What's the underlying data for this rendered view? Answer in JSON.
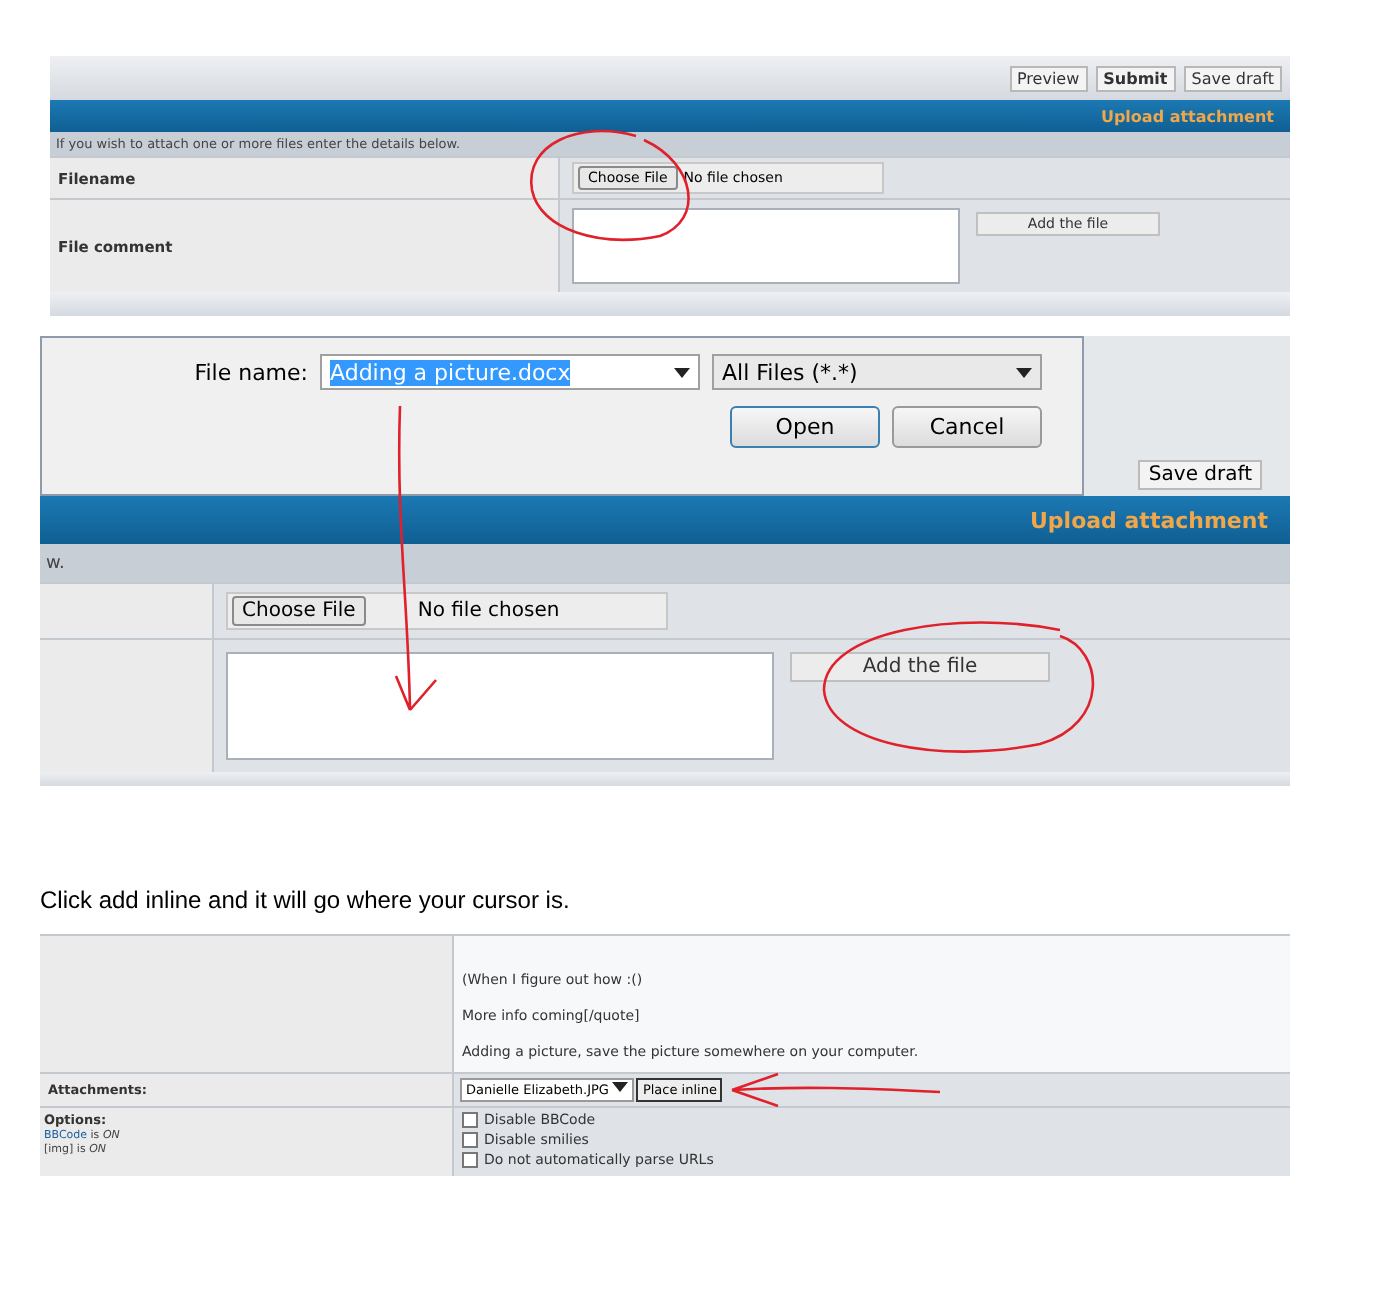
{
  "shot_upload_form": {
    "toolbar_buttons": [
      "Preview",
      "Submit",
      "Save draft"
    ],
    "header": "Upload attachment",
    "hint": "If you wish to attach one or more files enter the details below.",
    "filename_label": "Filename",
    "comment_label": "File comment",
    "choose_button": "Choose File",
    "no_file": "No file chosen",
    "add_button": "Add the file"
  },
  "shot_file_dialog": {
    "file_name_label": "File name:",
    "file_name_value": "Adding a picture.docx",
    "filter": "All Files (*.*)",
    "open_button": "Open",
    "cancel_button": "Cancel",
    "behind_button": "Save draft",
    "header": "Upload attachment",
    "hint_fragment": "w.",
    "choose_button": "Choose File",
    "no_file": "No file chosen",
    "add_button": "Add the file"
  },
  "caption": "Click add inline and it will go where your cursor is.",
  "shot_post_editor": {
    "message_lines": [
      "(When I figure out how :()",
      "More info coming[/quote]",
      "Adding a picture, save the picture somewhere on your computer."
    ],
    "attachments_label": "Attachments:",
    "attachment_select": "Danielle Elizabeth.JPG",
    "place_inline_button": "Place inline",
    "options_label": "Options:",
    "option_notes": [
      {
        "link": "BBCode",
        "text": "is *ON*"
      },
      {
        "text": "[img] is *ON*"
      }
    ],
    "checkboxes": [
      {
        "label": "Disable BBCode",
        "checked": false
      },
      {
        "label": "Disable smilies",
        "checked": false
      },
      {
        "label": "Do not automatically parse URLs",
        "checked": false
      }
    ]
  }
}
